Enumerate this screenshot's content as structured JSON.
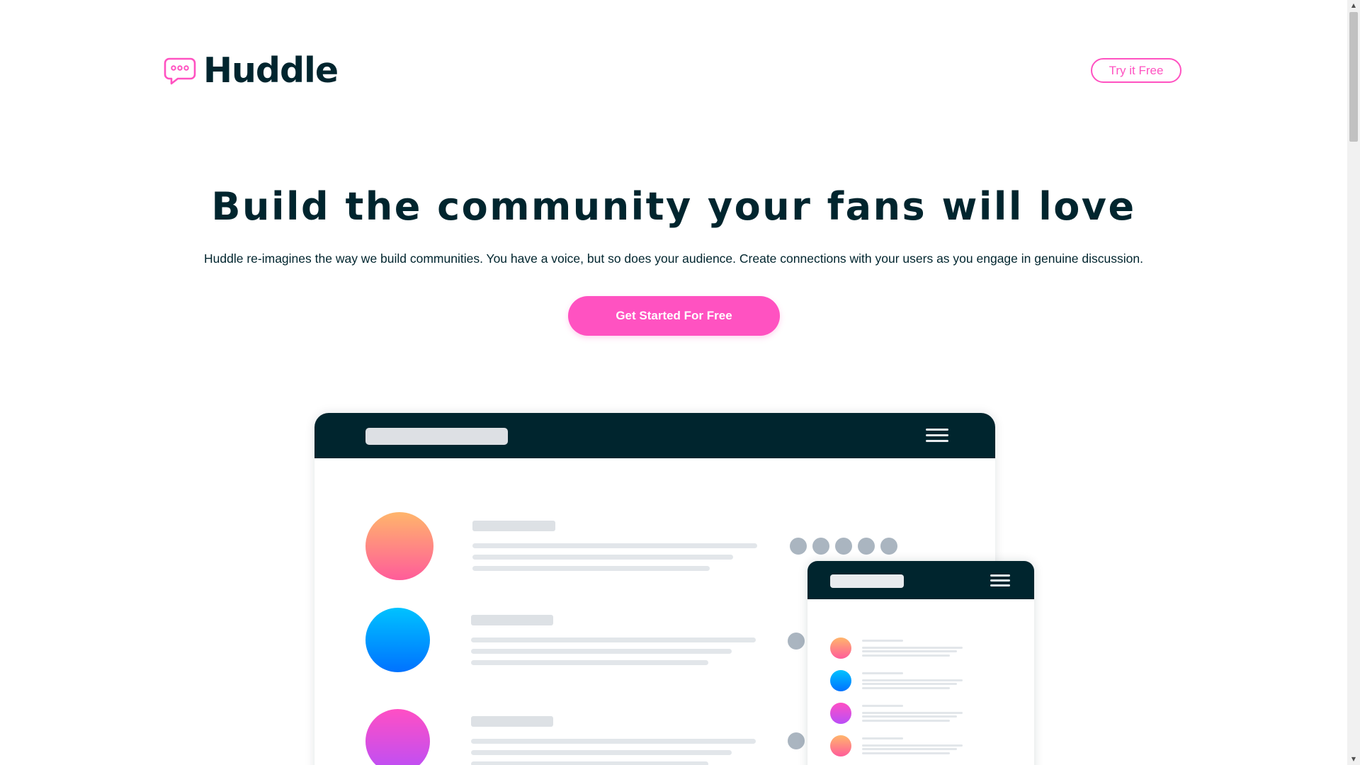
{
  "header": {
    "brand": "Huddle",
    "cta_label": "Try it Free"
  },
  "hero": {
    "title": "Build the community your fans will love",
    "description": "Huddle re-imagines the way we build communities. You have a voice, but so does your audience. Create connections with your users as you engage in genuine discussion.",
    "cta_label": "Get Started For Free"
  },
  "colors": {
    "primary_dark": "#00252e",
    "accent_pink": "#ff52c1",
    "white": "#ffffff"
  },
  "icons": {
    "logo": "chat-bubble-icon",
    "menu": "hamburger-menu-icon"
  }
}
